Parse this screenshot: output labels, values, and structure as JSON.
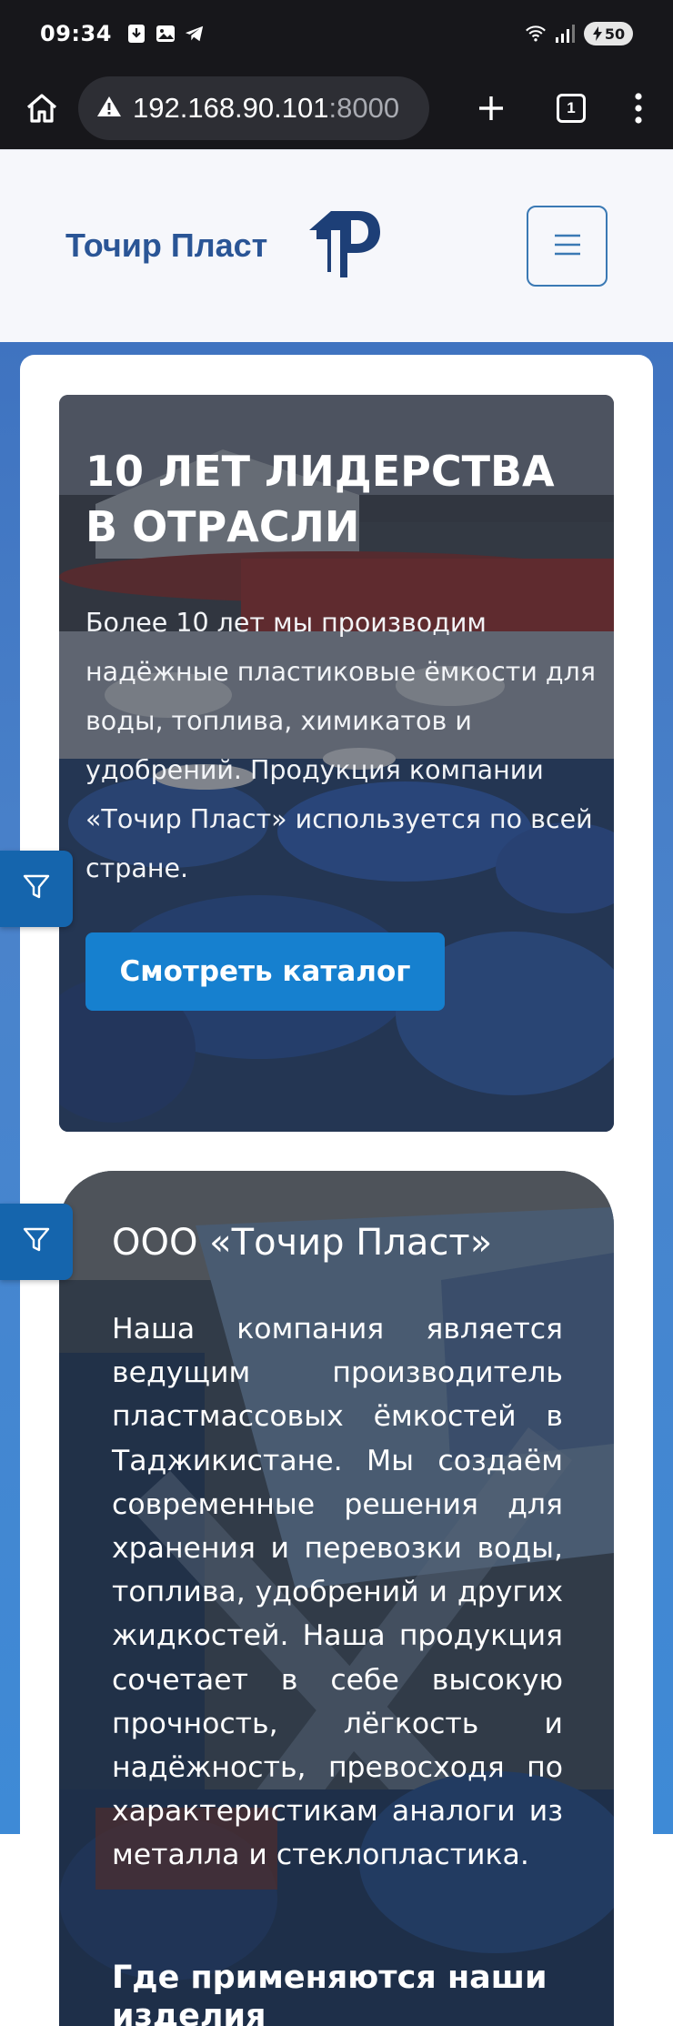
{
  "status_bar": {
    "time": "09:34",
    "battery_level": "50",
    "icons": [
      "download-icon",
      "image-icon",
      "telegram-icon",
      "wifi-icon",
      "signal-icon",
      "battery-icon"
    ]
  },
  "browser": {
    "url_host": "192.168.90.101",
    "url_port": ":8000",
    "tab_count": "1",
    "icons": [
      "home-icon",
      "warning-icon",
      "plus-icon",
      "tabs-icon",
      "menu-dots-icon"
    ]
  },
  "header": {
    "brand_name": "Точир Пласт",
    "brand_color": "#2a5596",
    "icons": [
      "logo-icon",
      "hamburger-icon"
    ]
  },
  "hero": {
    "title": "10 ЛЕТ ЛИДЕРСТВА В ОТРАСЛИ",
    "text": "Более 10 лет мы производим надёжные пластиковые ёмкости для воды, топлива, химикатов и удобрений. Продукция компании «Точир Пласт» используется по всей стране.",
    "button_label": "Смотреть каталог",
    "button_color": "#1680cf"
  },
  "about": {
    "title": "ООО «Точир Пласт»",
    "text": "Наша компания является ведущим производитель пластмассовых ёмкостей в Таджикистане. Мы создаём современные решения для хранения и перевозки воды, топлива, удобрений и других жидкостей. Наша продукция сочетает в себе высокую прочность, лёгкость и надёжность, превосходя по характеристикам аналоги из металла и стеклопластика.",
    "subtitle": "Где применяются наши изделия"
  },
  "filter": {
    "icon": "filter-icon",
    "color": "#1565ad"
  }
}
